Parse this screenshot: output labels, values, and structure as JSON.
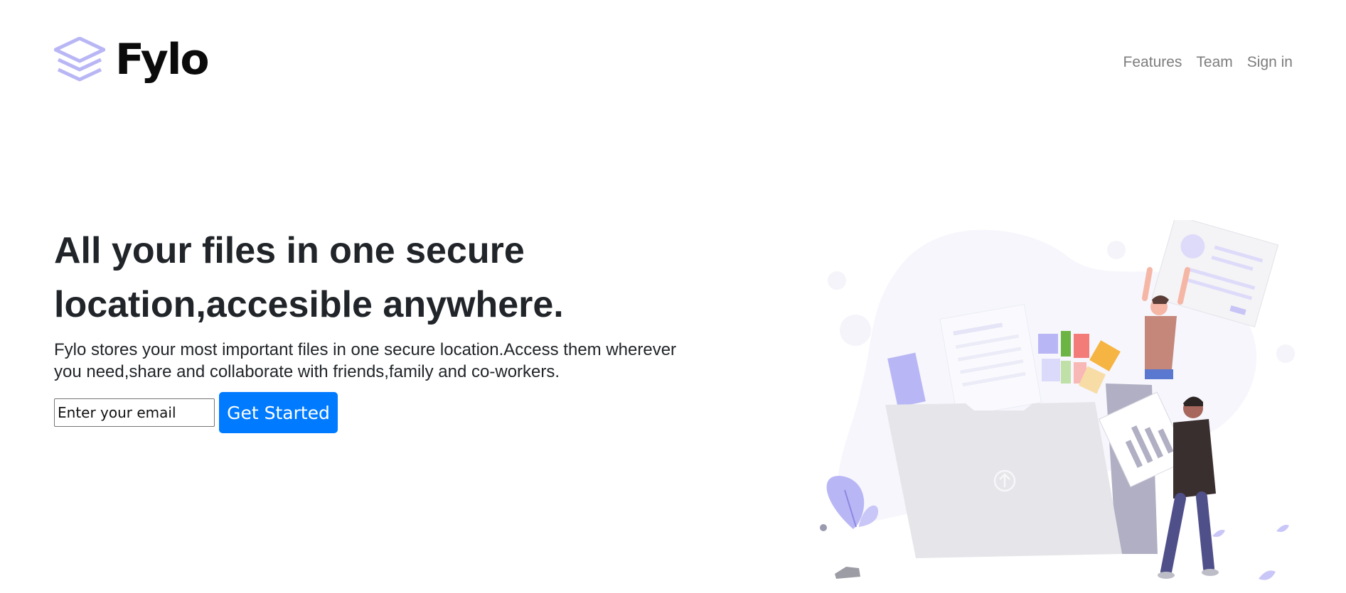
{
  "header": {
    "logo_text": "Fylo",
    "logo_icon": "layers-icon",
    "nav": [
      {
        "label": "Features"
      },
      {
        "label": "Team"
      },
      {
        "label": "Sign in"
      }
    ]
  },
  "hero": {
    "title": "All your files in one secure location,accesible anywhere.",
    "description": "Fylo stores your most important files in one secure location.Access them wherever you need,share and collaborate with friends,family and co-workers.",
    "email_placeholder": "Enter your email",
    "cta_label": "Get Started"
  },
  "colors": {
    "brand_accent": "#b9b6f5",
    "button": "#007bff",
    "nav_text": "#7d7d7d",
    "heading": "#212529"
  },
  "illustration": {
    "icon": "upload-arrow-icon"
  }
}
